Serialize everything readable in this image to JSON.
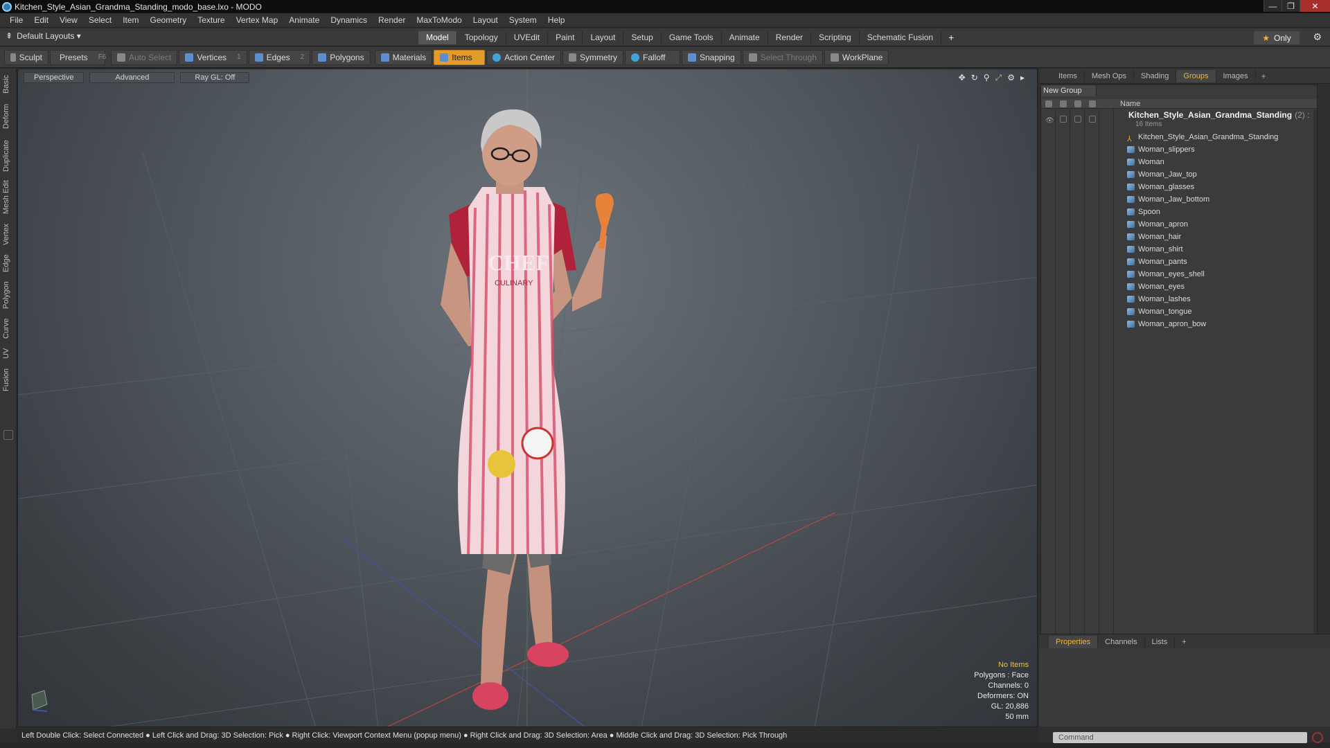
{
  "window": {
    "title": "Kitchen_Style_Asian_Grandma_Standing_modo_base.lxo - MODO",
    "controls": [
      "—",
      "❐",
      "✕"
    ]
  },
  "menubar": [
    "File",
    "Edit",
    "View",
    "Select",
    "Item",
    "Geometry",
    "Texture",
    "Vertex Map",
    "Animate",
    "Dynamics",
    "Render",
    "MaxToModo",
    "Layout",
    "System",
    "Help"
  ],
  "layoutbar": {
    "layout_name": "Default Layouts ▾",
    "tabs": [
      "Model",
      "Topology",
      "UVEdit",
      "Paint",
      "Layout",
      "Setup",
      "Game Tools",
      "Animate",
      "Render",
      "Scripting",
      "Schematic Fusion"
    ],
    "active_tab": "Model",
    "add": "+",
    "only_label": "Only"
  },
  "toolbar": {
    "sculpt": "Sculpt",
    "presets": "Presets",
    "presets_shortcut": "F6",
    "auto_select": "Auto Select",
    "vertices": "Vertices",
    "vertices_shortcut": "1",
    "edges": "Edges",
    "edges_shortcut": "2",
    "polygons": "Polygons",
    "materials": "Materials",
    "items": "Items",
    "action_center": "Action Center",
    "symmetry": "Symmetry",
    "falloff": "Falloff",
    "snapping": "Snapping",
    "select_through": "Select Through",
    "workplane": "WorkPlane"
  },
  "left_tabs": [
    "Basic",
    "Deform",
    "Duplicate",
    "Mesh Edit",
    "Vertex",
    "Edge",
    "Polygon",
    "Curve",
    "UV",
    "Fusion"
  ],
  "viewport": {
    "view": "Perspective",
    "shading": "Advanced",
    "raygl": "Ray GL: Off",
    "stats": {
      "selection": "No Items",
      "polygons": "Polygons : Face",
      "channels": "Channels: 0",
      "deformers": "Deformers: ON",
      "gl": "GL: 20,886",
      "lens": "50 mm"
    },
    "apron_text": "CHEF",
    "apron_sub": "CULINARY"
  },
  "statusbar": "Left Double Click: Select Connected ● Left Click and Drag: 3D Selection: Pick ● Right Click: Viewport Context Menu (popup menu) ● Right Click and Drag: 3D Selection: Area ● Middle Click and Drag: 3D Selection: Pick Through",
  "right_panel": {
    "tabs": [
      "Items",
      "Mesh Ops",
      "Shading",
      "Groups",
      "Images"
    ],
    "active_tab": "Groups",
    "add": "+",
    "new_group": "New Group",
    "column_name": "Name",
    "root": {
      "label": "Kitchen_Style_Asian_Grandma_Standing",
      "count": "(2) :",
      "subtitle": "16 Items"
    },
    "items": [
      "Kitchen_Style_Asian_Grandma_Standing",
      "Woman_slippers",
      "Woman",
      "Woman_Jaw_top",
      "Woman_glasses",
      "Woman_Jaw_bottom",
      "Spoon",
      "Woman_apron",
      "Woman_hair",
      "Woman_shirt",
      "Woman_pants",
      "Woman_eyes_shell",
      "Woman_eyes",
      "Woman_lashes",
      "Woman_tongue",
      "Woman_apron_bow"
    ],
    "bottom_tabs": [
      "Properties",
      "Channels",
      "Lists"
    ],
    "bottom_active": "Properties",
    "command_placeholder": "Command"
  },
  "colors": {
    "accent": "#e39b2a",
    "tab_highlight": "#f0b43c",
    "stats_warn": "#f0c040",
    "close_button": "#a8302a"
  }
}
